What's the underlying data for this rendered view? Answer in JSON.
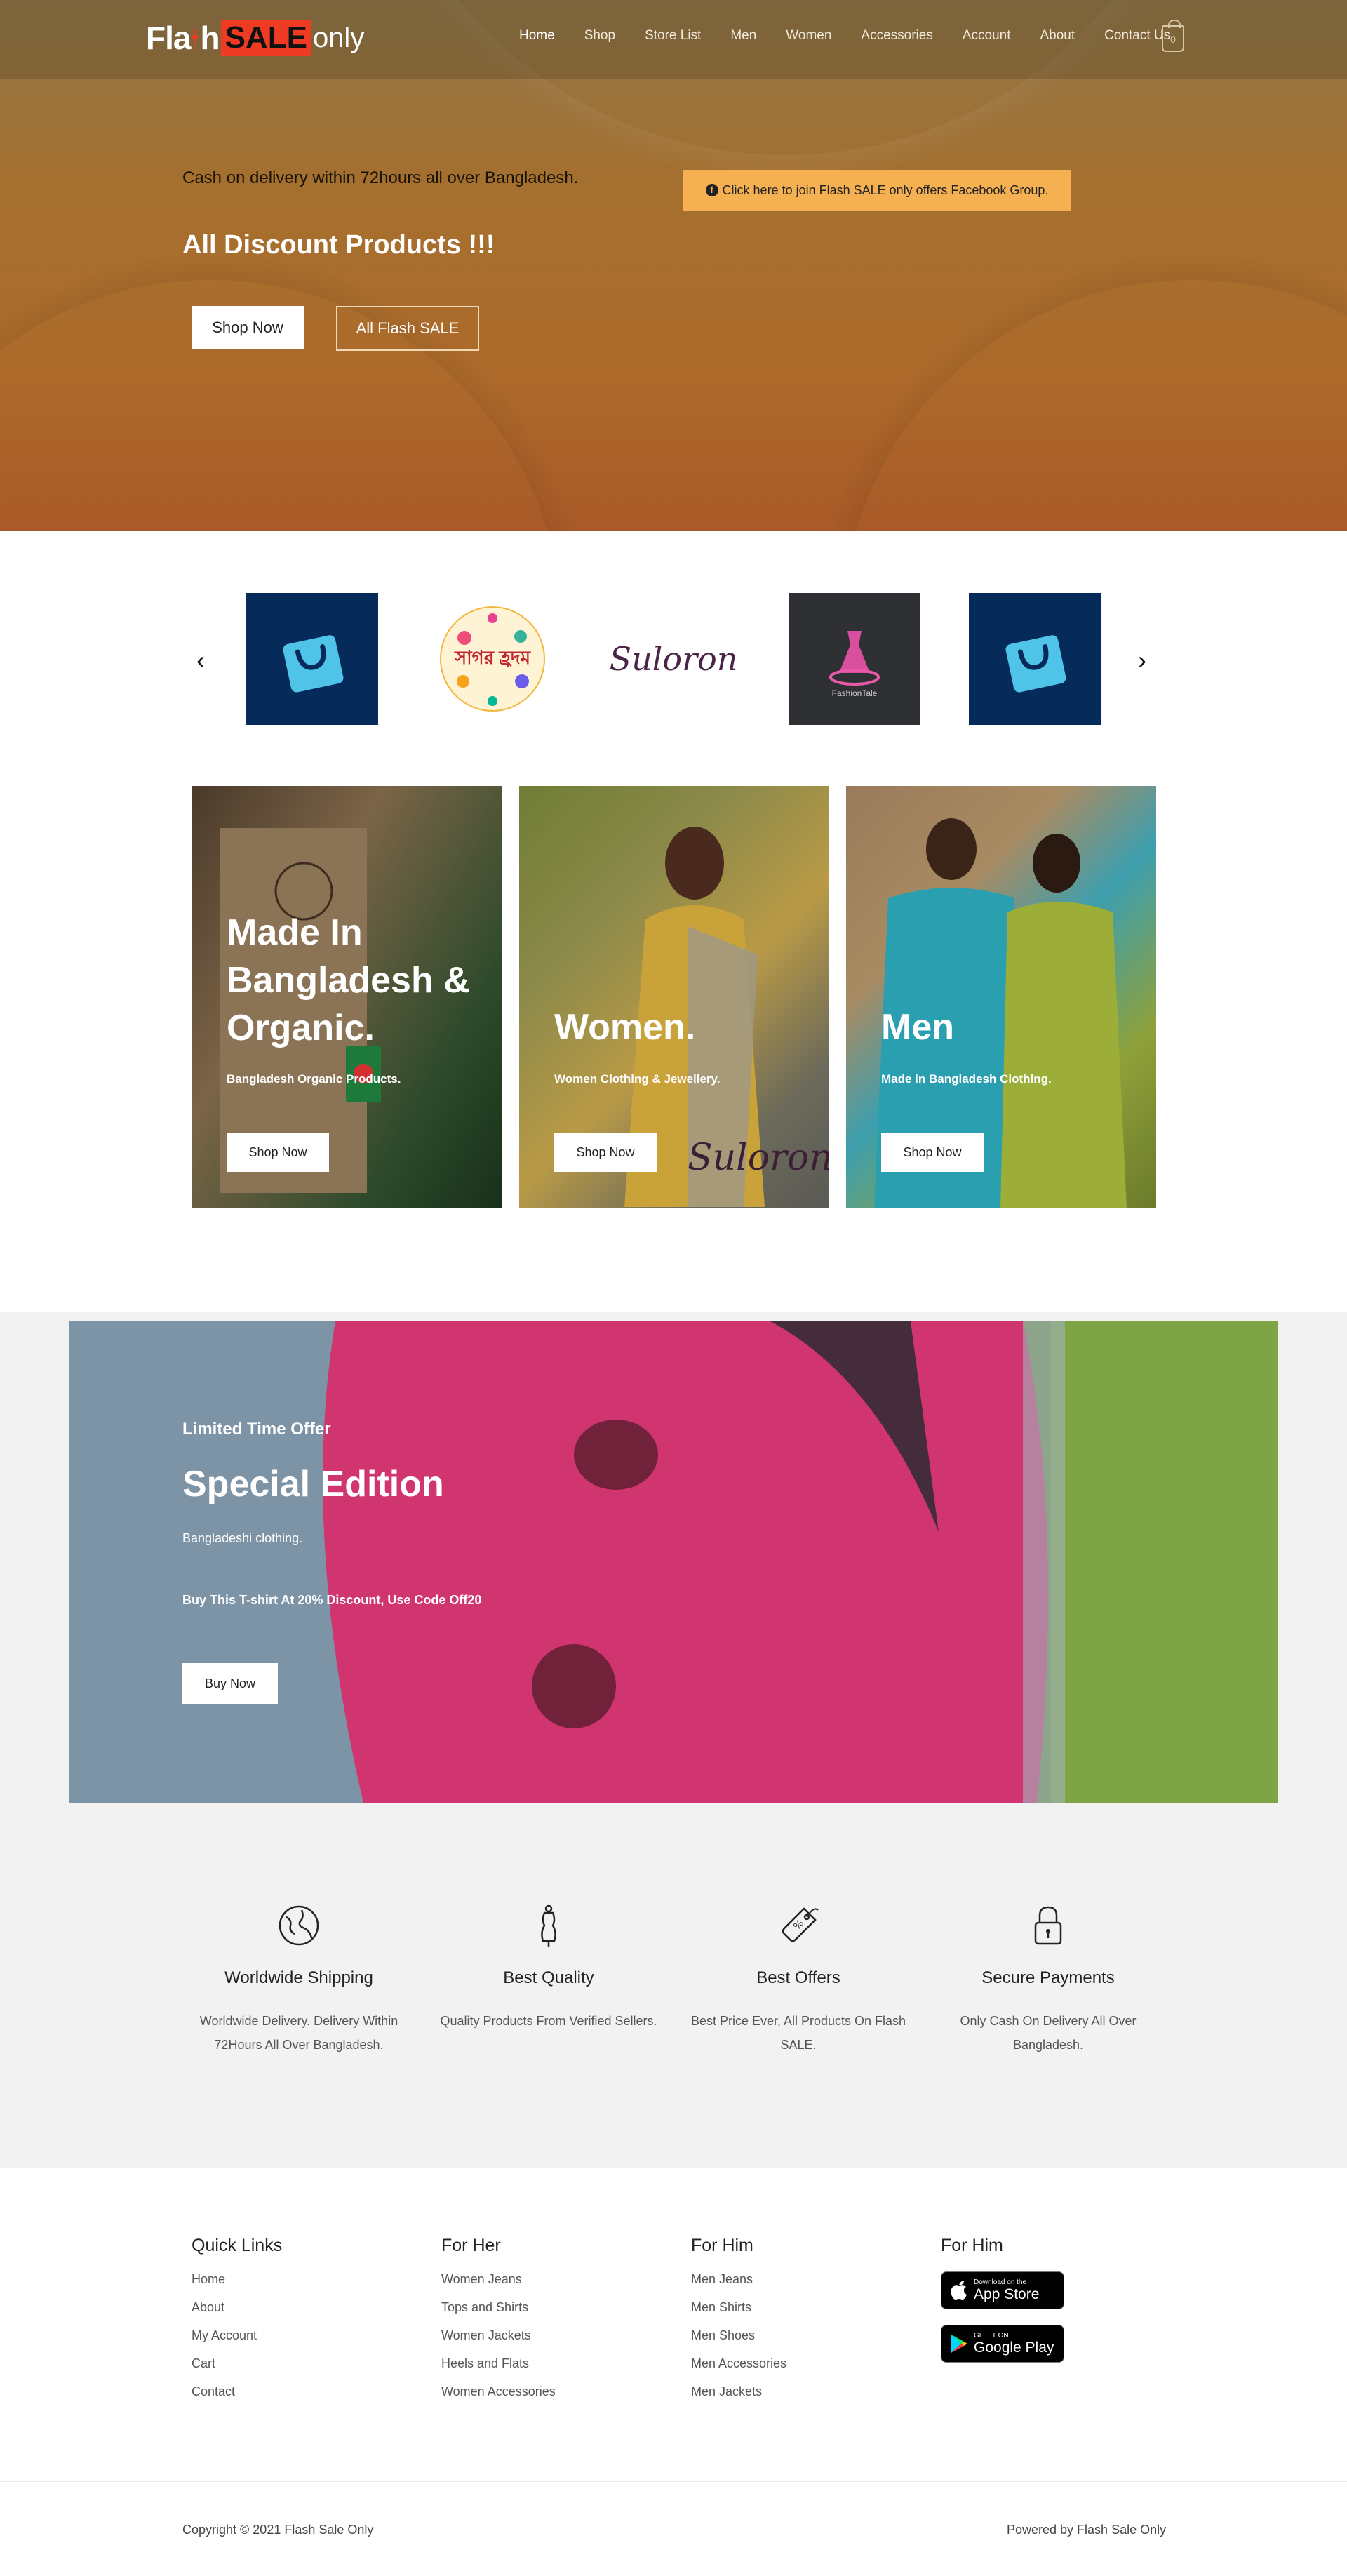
{
  "header": {
    "logo": {
      "part1": "Fla",
      "part1b": "h",
      "part2": "SALE",
      "part3": "only"
    },
    "nav": [
      "Home",
      "Shop",
      "Store List",
      "Men",
      "Women",
      "Accessories",
      "Account",
      "About",
      "Contact Us"
    ],
    "active_nav": "Home",
    "cart_count": "0"
  },
  "hero": {
    "delivery_text": "Cash on delivery within 72hours all over Bangladesh.",
    "title": "All Discount Products !!!",
    "shop_now": "Shop Now",
    "all_flash_sale": "All Flash SALE",
    "facebook_banner": "Click here to join Flash SALE only offers Facebook Group.",
    "facebook_icon": "facebook-icon"
  },
  "brands": {
    "prev_icon": "chevron-left-icon",
    "next_icon": "chevron-right-icon",
    "items": [
      {
        "name": "shopping-bag-logo",
        "text": "",
        "bg": "#062a5a"
      },
      {
        "name": "sagar-tudhm-logo",
        "text": "সাগর হ্রদম",
        "bg": "#ffffff"
      },
      {
        "name": "suloron-logo",
        "text": "Suloron",
        "bg": "#ffffff"
      },
      {
        "name": "fashion-tale-logo",
        "text": "FashionTale",
        "bg": "#2f3033"
      },
      {
        "name": "shopping-bag-logo-2",
        "text": "",
        "bg": "#062a5a"
      }
    ]
  },
  "categories": [
    {
      "title_lines": [
        "Made In",
        "Bangladesh &",
        "Organic."
      ],
      "subtitle": "Bangladesh Organic Products.",
      "button": "Shop Now"
    },
    {
      "title_lines": [
        "Women."
      ],
      "subtitle": "Women Clothing & Jewellery.",
      "button": "Shop Now",
      "watermark": "Suloron"
    },
    {
      "title_lines": [
        "Men"
      ],
      "subtitle": "Made in Bangladesh Clothing.",
      "button": "Shop Now"
    }
  ],
  "special": {
    "label": "Limited Time Offer",
    "title": "Special Edition",
    "subtitle": "Bangladeshi clothing.",
    "promo": "Buy This T-shirt At 20% Discount, Use Code Off20",
    "button": "Buy Now"
  },
  "features": [
    {
      "icon": "globe-icon",
      "title": "Worldwide Shipping",
      "desc": "Worldwide Delivery. Delivery Within 72Hours All Over Bangladesh."
    },
    {
      "icon": "mannequin-icon",
      "title": "Best Quality",
      "desc": "Quality Products From Verified Sellers."
    },
    {
      "icon": "price-tag-icon",
      "title": "Best Offers",
      "desc": "Best Price Ever, All Products On Flash SALE."
    },
    {
      "icon": "padlock-icon",
      "title": "Secure Payments",
      "desc": "Only Cash On Delivery All Over Bangladesh."
    }
  ],
  "footer": {
    "quick_links": {
      "title": "Quick Links",
      "items": [
        "Home",
        "About",
        "My Account",
        "Cart",
        "Contact"
      ]
    },
    "for_her": {
      "title": "For Her",
      "items": [
        "Women Jeans",
        "Tops and Shirts",
        "Women Jackets",
        "Heels and Flats",
        "Women Accessories"
      ]
    },
    "for_him": {
      "title": "For Him",
      "items": [
        "Men Jeans",
        "Men Shirts",
        "Men Shoes",
        "Men Accessories",
        "Men Jackets"
      ]
    },
    "apps": {
      "title": "For Him",
      "app_store": {
        "small": "Download on the",
        "big": "App Store",
        "icon": "apple-icon"
      },
      "google_play": {
        "small": "GET IT ON",
        "big": "Google Play",
        "icon": "google-play-icon"
      }
    },
    "copyright": "Copyright © 2021 Flash Sale Only",
    "powered": "Powered by Flash Sale Only"
  }
}
